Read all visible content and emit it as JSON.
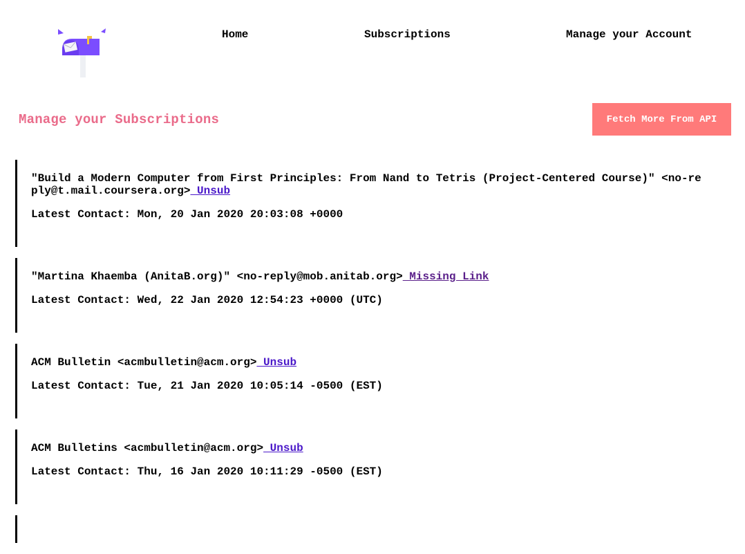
{
  "nav": {
    "home": "Home",
    "subscriptions": "Subscriptions",
    "account": "Manage your Account"
  },
  "logo": {
    "icon": "mailbox-icon"
  },
  "page": {
    "title": "Manage your Subscriptions",
    "fetch_button": "Fetch More From API"
  },
  "subscriptions": [
    {
      "sender": "\"Build a Modern Computer from First Principles: From Nand to Tetris (Project-Centered Course)\" <no-reply@t.mail.coursera.org>",
      "link": " Unsub",
      "contact": "Latest Contact: Mon, 20 Jan 2020 20:03:08 +0000"
    },
    {
      "sender": "\"Martina Khaemba (AnitaB.org)\" <no-reply@mob.anitab.org>",
      "link": " Missing Link",
      "contact": "Latest Contact: Wed, 22 Jan 2020 12:54:23 +0000 (UTC)"
    },
    {
      "sender": "ACM Bulletin <acmbulletin@acm.org>",
      "link": " Unsub",
      "contact": "Latest Contact: Tue, 21 Jan 2020 10:05:14 -0500 (EST)"
    },
    {
      "sender": "ACM Bulletins <acmbulletin@acm.org>",
      "link": " Unsub",
      "contact": "Latest Contact: Thu, 16 Jan 2020 10:11:29 -0500 (EST)"
    }
  ],
  "colors": {
    "title": "#ea6b8a",
    "button": "#ff7a7a",
    "link": "#4a18c9",
    "mailbox": "#7b4dff"
  }
}
